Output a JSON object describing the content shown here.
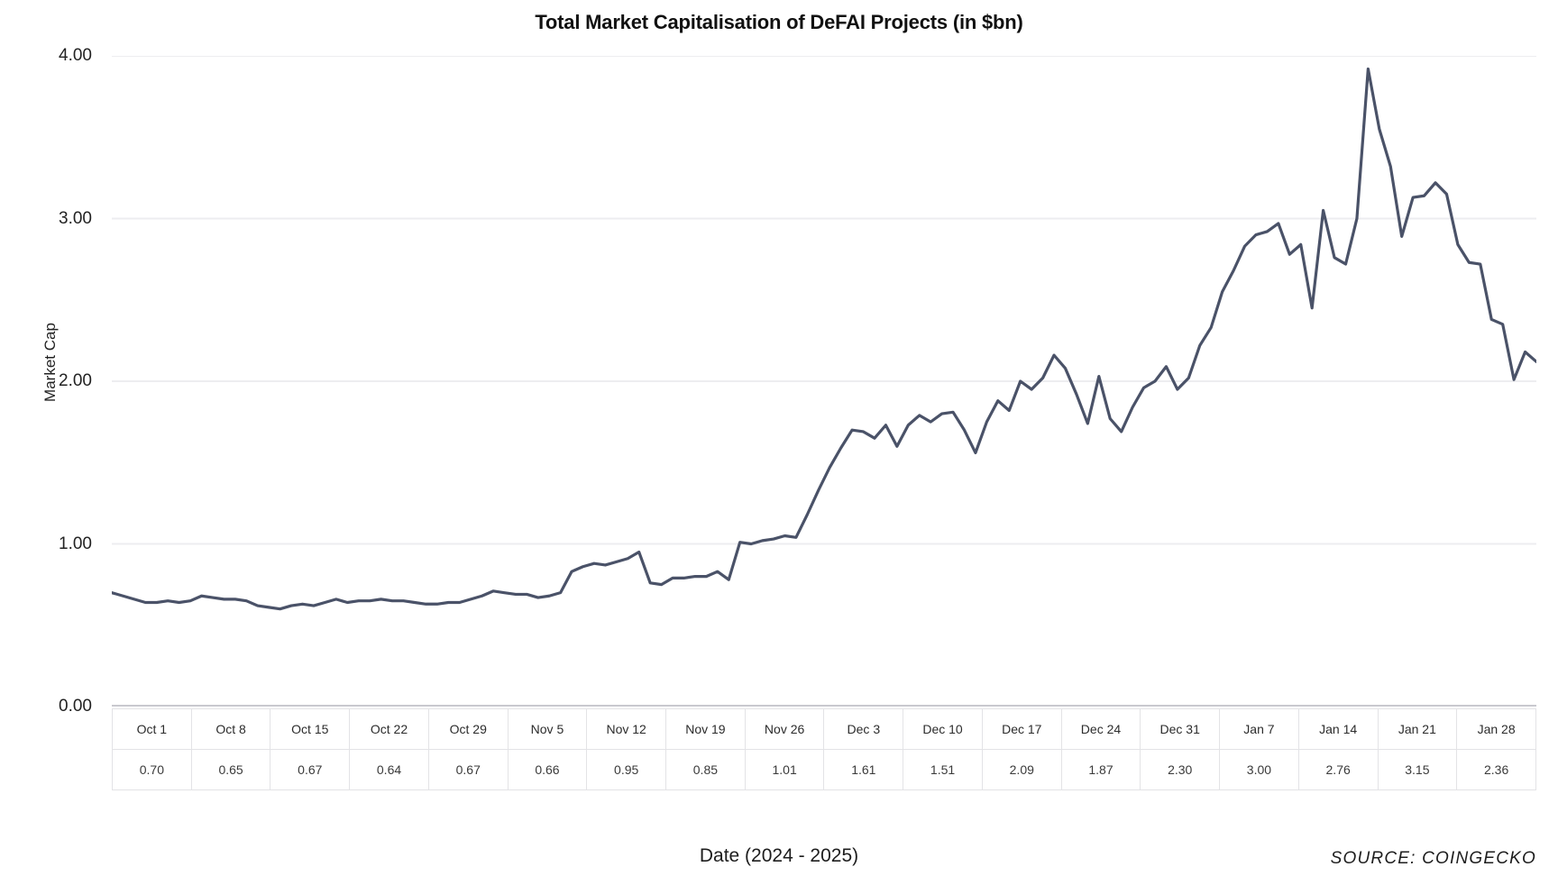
{
  "title": "Total Market Capitalisation of DeFAI Projects (in $bn)",
  "axis": {
    "y_label": "Market Cap",
    "x_label": "Date (2024 - 2025)",
    "y_ticks": [
      "0.00",
      "1.00",
      "2.00",
      "3.00",
      "4.00"
    ]
  },
  "source": "SOURCE: COINGECKO",
  "colors": {
    "line": "#4a5268",
    "grid": "#ededf0",
    "table_border": "#e3e3e6",
    "text": "#1a1a1a"
  },
  "table": {
    "dates": [
      "Oct 1",
      "Oct 8",
      "Oct 15",
      "Oct 22",
      "Oct 29",
      "Nov 5",
      "Nov 12",
      "Nov 19",
      "Nov 26",
      "Dec 3",
      "Dec 10",
      "Dec 17",
      "Dec 24",
      "Dec 31",
      "Jan 7",
      "Jan 14",
      "Jan 21",
      "Jan 28"
    ],
    "values": [
      "0.70",
      "0.65",
      "0.67",
      "0.64",
      "0.67",
      "0.66",
      "0.95",
      "0.85",
      "1.01",
      "1.61",
      "1.51",
      "2.09",
      "1.87",
      "2.30",
      "3.00",
      "2.76",
      "3.15",
      "2.36"
    ]
  },
  "chart_data": {
    "type": "line",
    "title": "Total Market Capitalisation of DeFAI Projects (in $bn)",
    "xlabel": "Date (2024 - 2025)",
    "ylabel": "Market Cap",
    "ylim": [
      0.0,
      4.0
    ],
    "yticks": [
      0.0,
      1.0,
      2.0,
      3.0,
      4.0
    ],
    "grid": true,
    "legend": "none",
    "line_color": "#4a5268",
    "source": "SOURCE: COINGECKO",
    "x_tick_labels": [
      "Oct 1",
      "Oct 8",
      "Oct 15",
      "Oct 22",
      "Oct 29",
      "Nov 5",
      "Nov 12",
      "Nov 19",
      "Nov 26",
      "Dec 3",
      "Dec 10",
      "Dec 17",
      "Dec 24",
      "Dec 31",
      "Jan 7",
      "Jan 14",
      "Jan 21",
      "Jan 28"
    ],
    "x_tick_values": [
      0.7,
      0.65,
      0.67,
      0.64,
      0.67,
      0.66,
      0.95,
      0.85,
      1.01,
      1.61,
      1.51,
      2.09,
      1.87,
      2.3,
      3.0,
      2.76,
      3.15,
      2.36
    ],
    "x": [
      "Oct 1",
      "Oct 2",
      "Oct 3",
      "Oct 4",
      "Oct 5",
      "Oct 6",
      "Oct 7",
      "Oct 8",
      "Oct 9",
      "Oct 10",
      "Oct 11",
      "Oct 12",
      "Oct 13",
      "Oct 14",
      "Oct 15",
      "Oct 16",
      "Oct 17",
      "Oct 18",
      "Oct 19",
      "Oct 20",
      "Oct 21",
      "Oct 22",
      "Oct 23",
      "Oct 24",
      "Oct 25",
      "Oct 26",
      "Oct 27",
      "Oct 28",
      "Oct 29",
      "Oct 30",
      "Oct 31",
      "Nov 1",
      "Nov 2",
      "Nov 3",
      "Nov 4",
      "Nov 5",
      "Nov 6",
      "Nov 7",
      "Nov 8",
      "Nov 9",
      "Nov 10",
      "Nov 11",
      "Nov 12",
      "Nov 13",
      "Nov 14",
      "Nov 15",
      "Nov 16",
      "Nov 17",
      "Nov 18",
      "Nov 19",
      "Nov 20",
      "Nov 21",
      "Nov 22",
      "Nov 23",
      "Nov 24",
      "Nov 25",
      "Nov 26",
      "Nov 27",
      "Nov 28",
      "Nov 29",
      "Nov 30",
      "Dec 1",
      "Dec 2",
      "Dec 3",
      "Dec 4",
      "Dec 5",
      "Dec 6",
      "Dec 7",
      "Dec 8",
      "Dec 9",
      "Dec 10",
      "Dec 11",
      "Dec 12",
      "Dec 13",
      "Dec 14",
      "Dec 15",
      "Dec 16",
      "Dec 17",
      "Dec 18",
      "Dec 19",
      "Dec 20",
      "Dec 21",
      "Dec 22",
      "Dec 23",
      "Dec 24",
      "Dec 25",
      "Dec 26",
      "Dec 27",
      "Dec 28",
      "Dec 29",
      "Dec 30",
      "Dec 31",
      "Jan 1",
      "Jan 2",
      "Jan 3",
      "Jan 4",
      "Jan 5",
      "Jan 6",
      "Jan 7",
      "Jan 8",
      "Jan 9",
      "Jan 10",
      "Jan 11",
      "Jan 12",
      "Jan 13",
      "Jan 14",
      "Jan 15",
      "Jan 16",
      "Jan 17",
      "Jan 18",
      "Jan 19",
      "Jan 20",
      "Jan 21",
      "Jan 22",
      "Jan 23",
      "Jan 24",
      "Jan 25",
      "Jan 26",
      "Jan 27",
      "Jan 28",
      "Jan 29",
      "Jan 30"
    ],
    "y": [
      0.7,
      0.68,
      0.66,
      0.64,
      0.64,
      0.65,
      0.64,
      0.65,
      0.68,
      0.67,
      0.66,
      0.66,
      0.65,
      0.62,
      0.61,
      0.6,
      0.62,
      0.63,
      0.62,
      0.64,
      0.66,
      0.64,
      0.65,
      0.65,
      0.66,
      0.65,
      0.65,
      0.64,
      0.63,
      0.63,
      0.64,
      0.64,
      0.66,
      0.68,
      0.71,
      0.7,
      0.69,
      0.69,
      0.67,
      0.68,
      0.7,
      0.83,
      0.86,
      0.88,
      0.87,
      0.89,
      0.91,
      0.95,
      0.76,
      0.75,
      0.79,
      0.79,
      0.8,
      0.8,
      0.83,
      0.78,
      1.01,
      1.0,
      1.02,
      1.03,
      1.05,
      1.04,
      1.18,
      1.33,
      1.47,
      1.59,
      1.7,
      1.69,
      1.65,
      1.73,
      1.6,
      1.73,
      1.79,
      1.75,
      1.8,
      1.81,
      1.7,
      1.56,
      1.75,
      1.88,
      1.82,
      2.0,
      1.95,
      2.02,
      2.16,
      2.08,
      1.92,
      1.74,
      2.03,
      1.77,
      1.69,
      1.84,
      1.96,
      2.0,
      2.09,
      1.95,
      2.02,
      2.22,
      2.33,
      2.55,
      2.68,
      2.83,
      2.9,
      2.92,
      2.97,
      2.78,
      2.84,
      2.45,
      3.05,
      2.76,
      2.72,
      3.0,
      3.92,
      3.55,
      3.32,
      2.89,
      3.13,
      3.14,
      3.22,
      3.15,
      2.84,
      2.73,
      2.72,
      2.38,
      2.35,
      2.01,
      2.18,
      2.12
    ]
  }
}
